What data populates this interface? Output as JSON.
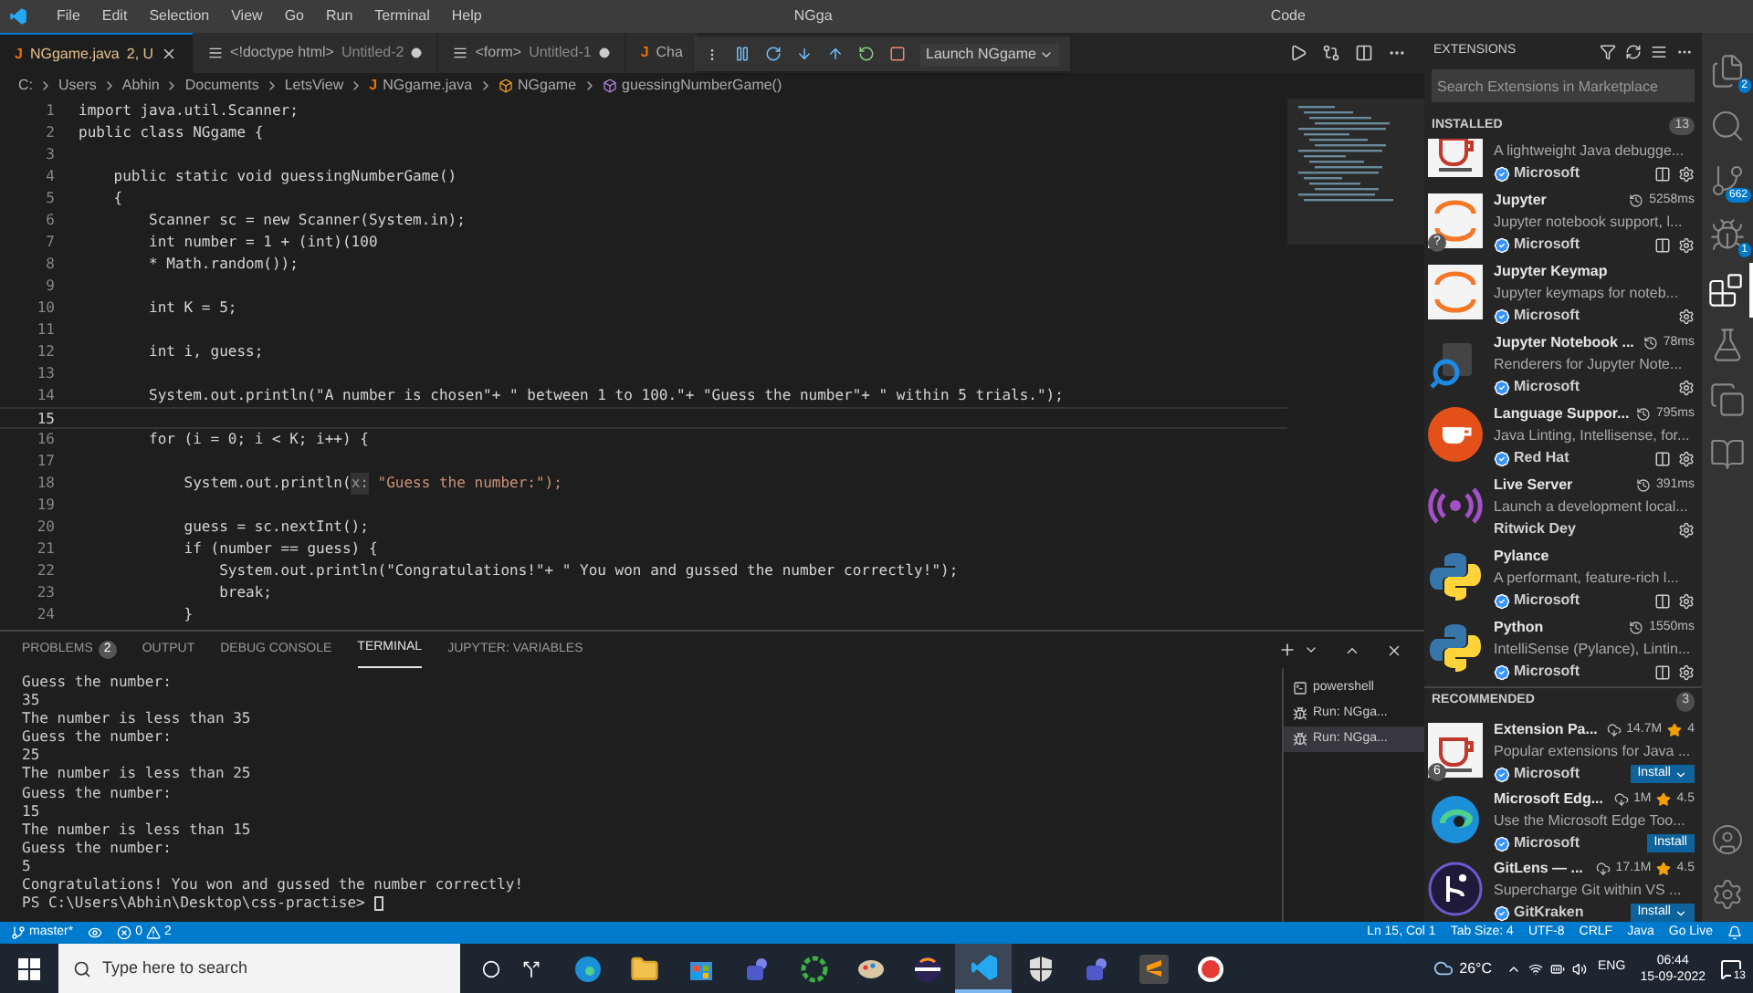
{
  "menu": [
    "File",
    "Edit",
    "Selection",
    "View",
    "Go",
    "Run",
    "Terminal",
    "Help"
  ],
  "title_fragments": [
    "NGga",
    "Code"
  ],
  "editor_tabs": [
    {
      "icon": "J",
      "label": "NGgame.java",
      "detail": "2, U",
      "selected": true,
      "dirty": false,
      "kind": "java"
    },
    {
      "label": "<!doctype html>",
      "detail": "Untitled-2",
      "selected": false,
      "dirty": true,
      "kind": "html"
    },
    {
      "label": "<form>",
      "detail": "Untitled-1",
      "selected": false,
      "dirty": true,
      "kind": "html"
    },
    {
      "icon": "J",
      "label": "Cha",
      "selected": false,
      "dirty": false,
      "kind": "java"
    }
  ],
  "debug_toolbar": {
    "config": "Launch NGgame"
  },
  "breadcrumb": [
    {
      "label": "C:",
      "kind": "folder"
    },
    {
      "label": "Users",
      "kind": "folder"
    },
    {
      "label": "Abhin",
      "kind": "folder"
    },
    {
      "label": "Documents",
      "kind": "folder"
    },
    {
      "label": "LetsView",
      "kind": "folder"
    },
    {
      "icon": "J",
      "label": "NGgame.java",
      "kind": "java"
    },
    {
      "label": "NGgame",
      "kind": "class"
    },
    {
      "label": "guessingNumberGame()",
      "kind": "method"
    }
  ],
  "code_lines": [
    {
      "n": "1",
      "text": "import java.util.Scanner;",
      "selected": false
    },
    {
      "n": "2",
      "text": "public class NGgame {",
      "selected": false
    },
    {
      "n": "3",
      "selected": false
    },
    {
      "n": "4",
      "text": "    public static void guessingNumberGame()",
      "selected": false
    },
    {
      "n": "5",
      "text": "    {",
      "selected": false
    },
    {
      "n": "6",
      "text": "        Scanner sc = new Scanner(System.in);",
      "selected": false
    },
    {
      "n": "7",
      "text": "        int number = 1 + (int)(100",
      "selected": false
    },
    {
      "n": "8",
      "text": "        * Math.random());",
      "selected": false
    },
    {
      "n": "9",
      "selected": false
    },
    {
      "n": "10",
      "text": "        int K = 5;",
      "selected": false
    },
    {
      "n": "11",
      "selected": false
    },
    {
      "n": "12",
      "text": "        int i, guess;",
      "selected": false
    },
    {
      "n": "13",
      "selected": false
    },
    {
      "n": "14",
      "text": "        System.out.println(\"A number is chosen\"+ \" between 1 to 100.\"+ \"Guess the number\"+ \" within 5 trials.\");",
      "selected": false
    },
    {
      "n": "15",
      "selected": true
    },
    {
      "n": "16",
      "text": "        for (i = 0; i < K; i++) {",
      "selected": false
    },
    {
      "n": "17",
      "selected": false
    },
    {
      "n": "18",
      "text": "            System.out.println(",
      "hint": "x:",
      "after": " \"Guess the number:\");",
      "selected": false
    },
    {
      "n": "19",
      "selected": false
    },
    {
      "n": "20",
      "text": "            guess = sc.nextInt();",
      "selected": false
    },
    {
      "n": "21",
      "text": "            if (number == guess) {",
      "selected": false
    },
    {
      "n": "22",
      "text": "                System.out.println(\"Congratulations!\"+ \" You won and gussed the number correctly!\");",
      "selected": false
    },
    {
      "n": "23",
      "text": "                break;",
      "selected": false
    },
    {
      "n": "24",
      "text": "            }",
      "selected": false
    }
  ],
  "panel_tabs": [
    {
      "label": "PROBLEMS",
      "badge": "2",
      "selected": false
    },
    {
      "label": "OUTPUT",
      "selected": false
    },
    {
      "label": "DEBUG CONSOLE",
      "selected": false
    },
    {
      "label": "TERMINAL",
      "selected": true
    },
    {
      "label": "JUPYTER: VARIABLES",
      "selected": false
    }
  ],
  "terminal_lines": [
    "Guess the number:",
    "35",
    "The number is less than 35",
    "Guess the number:",
    "25",
    "The number is less than 25",
    "Guess the number:",
    "15",
    "The number is less than 15",
    "Guess the number:",
    "5",
    "Congratulations! You won and gussed the number correctly!",
    "PS C:\\Users\\Abhin\\Desktop\\css-practise> "
  ],
  "terminals": [
    {
      "label": "powershell",
      "kind": "shell",
      "selected": false
    },
    {
      "label": "Run: NGga...",
      "kind": "debug",
      "selected": false
    },
    {
      "label": "Run: NGga...",
      "kind": "debug",
      "selected": true
    }
  ],
  "sidebar": {
    "title": "EXTENSIONS",
    "search_placeholder": "Search Extensions in Marketplace",
    "installed": {
      "title": "INSTALLED",
      "count": "13",
      "items": [
        {
          "kind": "cup",
          "description": "A lightweight Java debugge...",
          "publisher": "Microsoft",
          "verified": true,
          "split": true
        },
        {
          "name": "Jupyter",
          "stat": "5258ms",
          "kind": "jupyter",
          "icon_badge": "?",
          "description": "Jupyter notebook support, l...",
          "publisher": "Microsoft",
          "verified": true,
          "split": true
        },
        {
          "name": "Jupyter Keymap",
          "kind": "jupyter",
          "description": "Jupyter keymaps for noteb...",
          "publisher": "Microsoft",
          "verified": true,
          "split": false
        },
        {
          "name": "Jupyter Notebook ...",
          "stat": "78ms",
          "kind": "notebook",
          "description": "Renderers for Jupyter Note...",
          "publisher": "Microsoft",
          "verified": true,
          "split": false
        },
        {
          "name": "Language Suppor...",
          "stat": "795ms",
          "kind": "redcup",
          "description": "Java Linting, Intellisense, for...",
          "publisher": "Red Hat",
          "verified": true,
          "split": true
        },
        {
          "name": "Live Server",
          "stat": "391ms",
          "kind": "live",
          "description": "Launch a development local...",
          "publisher": "Ritwick Dey",
          "verified": false,
          "split": false
        },
        {
          "name": "Pylance",
          "kind": "python",
          "description": "A performant, feature-rich l...",
          "publisher": "Microsoft",
          "verified": true,
          "split": true
        },
        {
          "name": "Python",
          "stat": "1550ms",
          "kind": "python",
          "description": "IntelliSense (Pylance), Lintin...",
          "publisher": "Microsoft",
          "verified": true,
          "split": true
        }
      ]
    },
    "recommended": {
      "title": "RECOMMENDED",
      "count": "3",
      "items": [
        {
          "name": "Extension Pa...",
          "downloads": "14.7M",
          "rating": "4",
          "kind": "cup",
          "icon_badge": "6",
          "description": "Popular extensions for Java ...",
          "publisher": "Microsoft",
          "verified": true,
          "install": "Install",
          "dropdown": true
        },
        {
          "name": "Microsoft Edg...",
          "downloads": "1M",
          "rating": "4.5",
          "kind": "edge",
          "description": "Use the Microsoft Edge Too...",
          "publisher": "Microsoft",
          "verified": true,
          "install": "Install",
          "dropdown": false
        },
        {
          "name": "GitLens — ...",
          "downloads": "17.1M",
          "rating": "4.5",
          "kind": "gitlens",
          "description": "Supercharge Git within VS ...",
          "publisher": "GitKraken",
          "verified": true,
          "install": "Install",
          "dropdown": true
        }
      ]
    }
  },
  "activity_bar": [
    {
      "kind": "files",
      "badge": "2",
      "selected": false
    },
    {
      "kind": "search",
      "selected": false
    },
    {
      "kind": "git",
      "badge": "662",
      "selected": false
    },
    {
      "kind": "debug",
      "badge": "1",
      "selected": false
    },
    {
      "kind": "extensions",
      "selected": true
    },
    {
      "kind": "flask",
      "selected": false
    },
    {
      "kind": "remote",
      "selected": false
    },
    {
      "kind": "book",
      "selected": false
    }
  ],
  "status_bar": {
    "branch": "master*",
    "errors": "0",
    "warnings": "2",
    "right": [
      "Ln 15, Col 1",
      "Tab Size: 4",
      "UTF-8",
      "CRLF",
      "Java",
      "Go Live"
    ]
  },
  "taskbar": {
    "search_placeholder": "Type here to search",
    "apps": [
      {
        "kind": "edge",
        "active": false
      },
      {
        "kind": "folder",
        "active": false
      },
      {
        "kind": "store",
        "active": false
      },
      {
        "kind": "teams",
        "active": false
      },
      {
        "kind": "ring",
        "active": false
      },
      {
        "kind": "paint",
        "active": false
      },
      {
        "kind": "eclipse",
        "active": false
      },
      {
        "kind": "vscode",
        "active": true
      },
      {
        "kind": "shield",
        "active": false
      },
      {
        "kind": "teams",
        "active": false
      },
      {
        "kind": "sublime",
        "active": false
      },
      {
        "kind": "record",
        "active": false
      }
    ],
    "weather": "26°C",
    "language": "ENG",
    "time": "06:44",
    "date": "15-09-2022",
    "notifications": "13"
  }
}
